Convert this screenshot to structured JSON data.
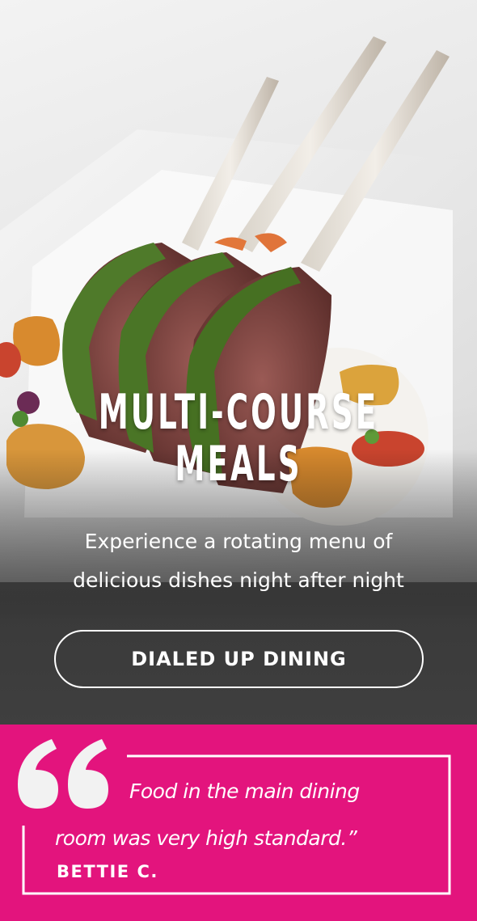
{
  "hero": {
    "title_line1": "MULTI-COURSE",
    "title_line2": "MEALS",
    "subtitle_line1": "Experience a rotating menu of",
    "subtitle_line2": "delicious dishes night after night",
    "cta_label": "DIALED UP DINING"
  },
  "testimonial": {
    "quote_line1": "Food in the main dining",
    "quote_line2": "room was very high standard.”",
    "author": "BETTIE C.",
    "background_color": "#e3147d",
    "icon": "quote-open-icon"
  }
}
